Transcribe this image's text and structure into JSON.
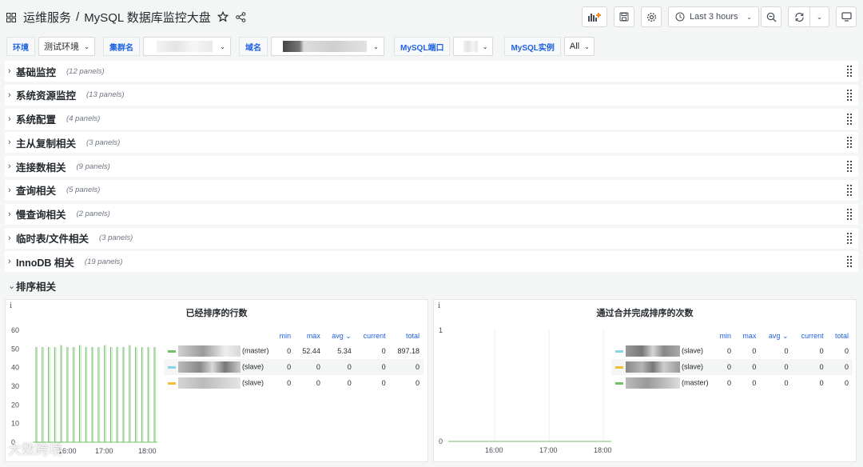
{
  "header": {
    "folder": "运维服务",
    "separator": "/",
    "dashboard": "MySQL 数据库监控大盘",
    "time_range": "Last 3 hours"
  },
  "variables": [
    {
      "label": "环境",
      "value": "测试环境"
    },
    {
      "label": "集群名",
      "value": ""
    },
    {
      "label": "域名",
      "value": ""
    },
    {
      "label": "MySQL端口",
      "value": ""
    },
    {
      "label": "MySQL实例",
      "value": "All"
    }
  ],
  "rows": [
    {
      "title": "基础监控",
      "count": "(12 panels)"
    },
    {
      "title": "系统资源监控",
      "count": "(13 panels)"
    },
    {
      "title": "系统配置",
      "count": "(4 panels)"
    },
    {
      "title": "主从复制相关",
      "count": "(3 panels)"
    },
    {
      "title": "连接数相关",
      "count": "(9 panels)"
    },
    {
      "title": "查询相关",
      "count": "(5 panels)"
    },
    {
      "title": "慢查询相关",
      "count": "(2 panels)"
    },
    {
      "title": "临时表/文件相关",
      "count": "(3 panels)"
    },
    {
      "title": "InnoDB 相关",
      "count": "(19 panels)"
    }
  ],
  "open_row": {
    "title": "排序相关"
  },
  "colors": {
    "green": "#73bf69",
    "cyan": "#8ad5e3",
    "yellow": "#f2c038",
    "accent": "#1f62e0"
  },
  "panels": [
    {
      "title": "已经排序的行数",
      "info": "i",
      "legend_headers": [
        "min",
        "max",
        "avg",
        "current",
        "total"
      ],
      "legend_rows": [
        {
          "name": "(master)",
          "color": "green",
          "min": "0",
          "max": "52.44",
          "avg": "5.34",
          "current": "0",
          "total": "897.18"
        },
        {
          "name": "(slave)",
          "color": "cyan",
          "min": "0",
          "max": "0",
          "avg": "0",
          "current": "0",
          "total": "0"
        },
        {
          "name": "(slave)",
          "color": "yellow",
          "min": "0",
          "max": "0",
          "avg": "0",
          "current": "0",
          "total": "0"
        }
      ]
    },
    {
      "title": "通过合并完成排序的次数",
      "info": "i",
      "legend_headers": [
        "min",
        "max",
        "avg",
        "current",
        "total"
      ],
      "legend_rows": [
        {
          "name": "(slave)",
          "color": "cyan",
          "min": "0",
          "max": "0",
          "avg": "0",
          "current": "0",
          "total": "0"
        },
        {
          "name": "(slave)",
          "color": "yellow",
          "min": "0",
          "max": "0",
          "avg": "0",
          "current": "0",
          "total": "0"
        },
        {
          "name": "(master)",
          "color": "green",
          "min": "0",
          "max": "0",
          "avg": "0",
          "current": "0",
          "total": "0"
        }
      ]
    }
  ],
  "chart_data": [
    {
      "type": "line",
      "title": "已经排序的行数",
      "y_ticks": [
        "0",
        "10",
        "20",
        "30",
        "40",
        "50",
        "60"
      ],
      "x_ticks": [
        "16:00",
        "17:00",
        "18:00"
      ],
      "ylim": [
        0,
        60
      ],
      "series": [
        {
          "name": "(master)",
          "color": "#73bf69",
          "spikes": [
            51,
            51,
            51,
            51,
            52,
            51,
            51,
            52,
            51,
            51,
            51,
            52,
            51,
            51,
            51,
            52,
            51,
            51,
            51,
            51
          ]
        },
        {
          "name": "(slave)",
          "color": "#8ad5e3",
          "spikes": []
        },
        {
          "name": "(slave)",
          "color": "#f2c038",
          "spikes": []
        }
      ]
    },
    {
      "type": "line",
      "title": "通过合并完成排序的次数",
      "y_ticks": [
        "0",
        "1"
      ],
      "x_ticks": [
        "16:00",
        "17:00",
        "18:00"
      ],
      "ylim": [
        0,
        1
      ],
      "series": [
        {
          "name": "(slave)",
          "color": "#8ad5e3",
          "values": [
            0,
            0
          ]
        },
        {
          "name": "(slave)",
          "color": "#f2c038",
          "values": [
            0,
            0
          ]
        },
        {
          "name": "(master)",
          "color": "#73bf69",
          "values": [
            0,
            0
          ]
        }
      ]
    }
  ],
  "watermark": "大数跨境"
}
